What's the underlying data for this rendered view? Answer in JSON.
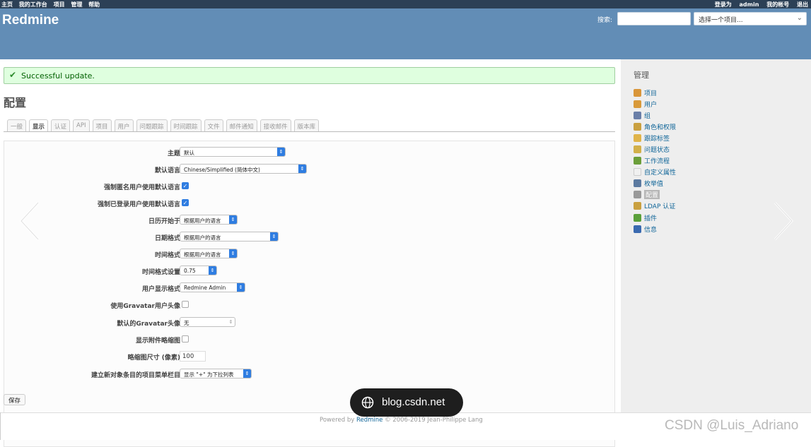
{
  "top_menu": {
    "left": [
      "主页",
      "我的工作台",
      "项目",
      "管理",
      "帮助"
    ],
    "logged_in_prefix": "登录为",
    "user": "admin",
    "my_account": "我的帐号",
    "logout": "退出"
  },
  "header": {
    "title": "Redmine",
    "search_label": "搜索:",
    "search_value": "",
    "project_jump": "选择一个项目..."
  },
  "flash": {
    "text": "Successful update."
  },
  "page_title": "配置",
  "tabs": [
    "一般",
    "显示",
    "认证",
    "API",
    "项目",
    "用户",
    "问题跟踪",
    "时间跟踪",
    "文件",
    "邮件通知",
    "接收邮件",
    "版本库"
  ],
  "selected_tab": "显示",
  "settings": [
    {
      "label": "主题",
      "type": "select",
      "value": "默认"
    },
    {
      "label": "默认语言",
      "type": "select",
      "value": "Chinese/Simplified (简体中文)"
    },
    {
      "label": "强制匿名用户使用默认语言",
      "type": "checkbox",
      "checked": true
    },
    {
      "label": "强制已登录用户使用默认语言",
      "type": "checkbox",
      "checked": true
    },
    {
      "label": "日历开始于",
      "type": "select",
      "value": "根据用户的语言"
    },
    {
      "label": "日期格式",
      "type": "select",
      "value": "根据用户的语言"
    },
    {
      "label": "时间格式",
      "type": "select",
      "value": "根据用户的语言"
    },
    {
      "label": "时间格式设置",
      "type": "select",
      "value": "0.75"
    },
    {
      "label": "用户显示格式",
      "type": "select",
      "value": "Redmine Admin"
    },
    {
      "label": "使用Gravatar用户头像",
      "type": "checkbox",
      "checked": false
    },
    {
      "label": "默认的Gravatar头像",
      "type": "select",
      "value": "无"
    },
    {
      "label": "显示附件略缩图",
      "type": "checkbox",
      "checked": false
    },
    {
      "label": "略缩图尺寸 (像素)",
      "type": "text",
      "value": "100"
    },
    {
      "label": "建立新对象条目的项目菜单栏目",
      "type": "select",
      "value": "显示 \"+\" 为下拉列表"
    }
  ],
  "save_label": "保存",
  "sidebar": {
    "title": "管理",
    "items": [
      {
        "label": "项目",
        "icon": "projects-icon",
        "color": "#d9963a"
      },
      {
        "label": "用户",
        "icon": "user-icon",
        "color": "#d99a3a"
      },
      {
        "label": "组",
        "icon": "group-icon",
        "color": "#6a7fa8"
      },
      {
        "label": "角色和权限",
        "icon": "roles-icon",
        "color": "#c9a040"
      },
      {
        "label": "跟踪标签",
        "icon": "trackers-icon",
        "color": "#e0b44a"
      },
      {
        "label": "问题状态",
        "icon": "issue-status-icon",
        "color": "#d2b04a"
      },
      {
        "label": "工作流程",
        "icon": "workflow-icon",
        "color": "#6b9e3a"
      },
      {
        "label": "自定义属性",
        "icon": "custom-fields-icon",
        "color": "#f0f0f0"
      },
      {
        "label": "枚举值",
        "icon": "enumerations-icon",
        "color": "#5c7aa0"
      },
      {
        "label": "配置",
        "icon": "settings-gear-icon",
        "color": "#999999",
        "selected": true
      },
      {
        "label": "LDAP 认证",
        "icon": "ldap-icon",
        "color": "#c9a040"
      },
      {
        "label": "插件",
        "icon": "plugins-icon",
        "color": "#5aa03a"
      },
      {
        "label": "信息",
        "icon": "info-icon",
        "color": "#3a6ab0"
      }
    ]
  },
  "footer": {
    "powered_prefix": "Powered by",
    "powered_link": "Redmine",
    "powered_suffix": "© 2006-2019 Jean-Philippe Lang"
  },
  "overlay": {
    "pill_text": "blog.csdn.net",
    "watermark": "CSDN @Luis_Adriano"
  }
}
